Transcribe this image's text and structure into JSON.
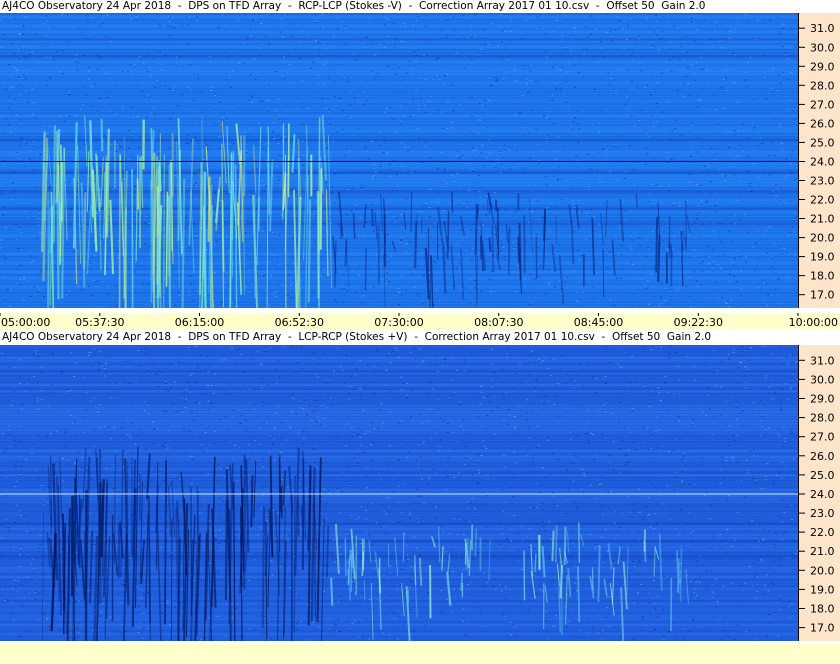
{
  "chart_data": [
    {
      "type": "heatmap",
      "title": "AJ4CO Observatory 24 Apr 2018  -  DPS on TFD Array  -  RCP-LCP (Stokes -V)  -  Correction Array 2017 01 10.csv  -  Offset 50  Gain 2.0",
      "xlabel": "",
      "ylabel": "",
      "x_ticks": [
        "05:00:00",
        "05:37:30",
        "06:15:00",
        "06:52:30",
        "07:30:00",
        "08:07:30",
        "08:45:00",
        "09:22:30",
        "10:00:00"
      ],
      "x_range": [
        "05:00:00",
        "10:00:00"
      ],
      "y_ticks": [
        31.0,
        30.0,
        29.0,
        28.0,
        27.0,
        26.0,
        25.0,
        24.0,
        23.0,
        22.0,
        21.0,
        20.0,
        19.0,
        18.0,
        17.0
      ],
      "y_tick_labels": [
        "31.0",
        "30.0",
        "29.0",
        "28.0",
        "27.0",
        "26.0",
        "25.0",
        "24.0",
        "23.0",
        "22.0",
        "21.0",
        "20.0",
        "19.0",
        "18.0",
        "17.0"
      ],
      "y_range": [
        16.3,
        31.8
      ],
      "background_color": "#1e78f0",
      "emission_polarity": "bright"
    },
    {
      "type": "heatmap",
      "title": "AJ4CO Observatory 24 Apr 2018  -  DPS on TFD Array  -  LCP-RCP (Stokes +V)  -  Correction Array 2017 01 10.csv  -  Offset 50  Gain 2.0",
      "xlabel": "",
      "ylabel": "",
      "x_ticks": [],
      "y_ticks": [
        31.0,
        30.0,
        29.0,
        28.0,
        27.0,
        26.0,
        25.0,
        24.0,
        23.0,
        22.0,
        21.0,
        20.0,
        19.0,
        18.0,
        17.0
      ],
      "y_tick_labels": [
        "31.0",
        "30.0",
        "29.0",
        "28.0",
        "27.0",
        "26.0",
        "25.0",
        "24.0",
        "23.0",
        "22.0",
        "21.0",
        "20.0",
        "19.0",
        "18.0",
        "17.0"
      ],
      "y_range": [
        16.3,
        31.8
      ],
      "background_color": "#2060e0",
      "emission_polarity": "dark"
    }
  ],
  "colors": {
    "axis_panel": "#fde5cc",
    "time_axis": "#ffffcc",
    "plot_a": "#1e78f0",
    "plot_b": "#2060e0"
  }
}
